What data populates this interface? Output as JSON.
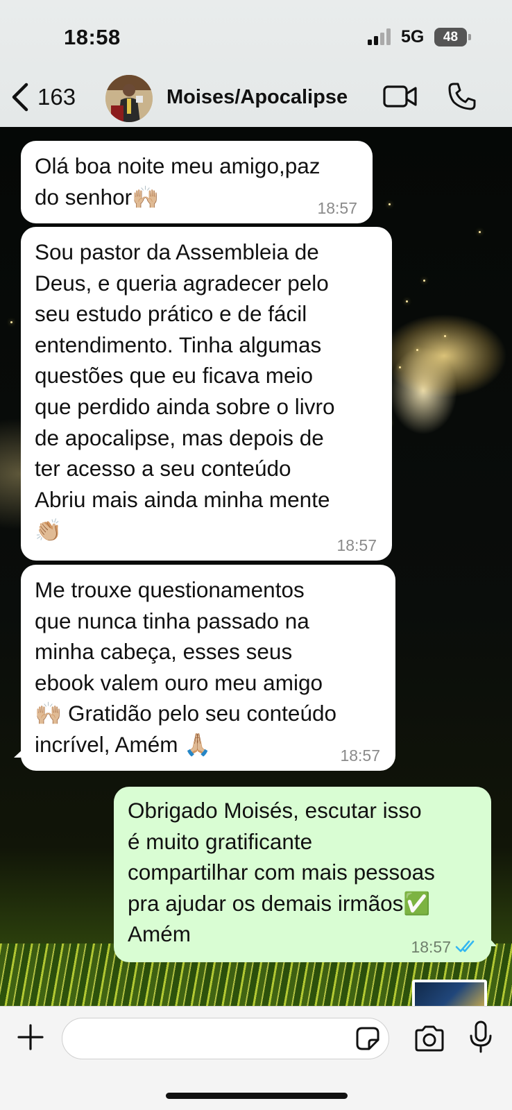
{
  "status_bar": {
    "time": "18:58",
    "network": "5G",
    "battery": "48"
  },
  "chat_header": {
    "back_count": "163",
    "contact_name": "Moises/Apocalipse"
  },
  "messages": [
    {
      "direction": "incoming",
      "text": "Olá boa noite meu amigo,paz\ndo senhor🙌🏼",
      "time": "18:57"
    },
    {
      "direction": "incoming",
      "text": "Sou pastor da Assembleia de\nDeus, e queria agradecer pelo\nseu estudo prático e de fácil\nentendimento. Tinha algumas\nquestões que eu ficava meio\nque perdido ainda sobre o livro\nde apocalipse, mas depois de\nter acesso a seu conteúdo\nAbriu mais ainda minha mente\n👏🏼",
      "time": "18:57"
    },
    {
      "direction": "incoming",
      "text": "Me trouxe questionamentos\nque nunca tinha passado na\nminha cabeça, esses seus\nebook valem ouro meu amigo\n🙌🏼 Gratidão pelo seu conteúdo\nincrível, Amém 🙏🏼",
      "time": "18:57"
    },
    {
      "direction": "outgoing",
      "text": "Obrigado Moisés, escutar isso\né muito gratificante\ncompartilhar com mais pessoas\npra ajudar os demais irmãos✅\nAmém",
      "time": "18:57",
      "status": "read"
    }
  ],
  "composer": {
    "placeholder": ""
  },
  "colors": {
    "incoming_bubble": "#ffffff",
    "outgoing_bubble": "#d9fdd3",
    "read_ticks": "#34b7f1",
    "header_bg": "#e9ecec"
  },
  "icons": [
    "chevron-left-icon",
    "video-call-icon",
    "phone-icon",
    "plus-icon",
    "sticker-icon",
    "camera-icon",
    "microphone-icon",
    "signal-icon",
    "battery-icon",
    "double-check-icon"
  ]
}
